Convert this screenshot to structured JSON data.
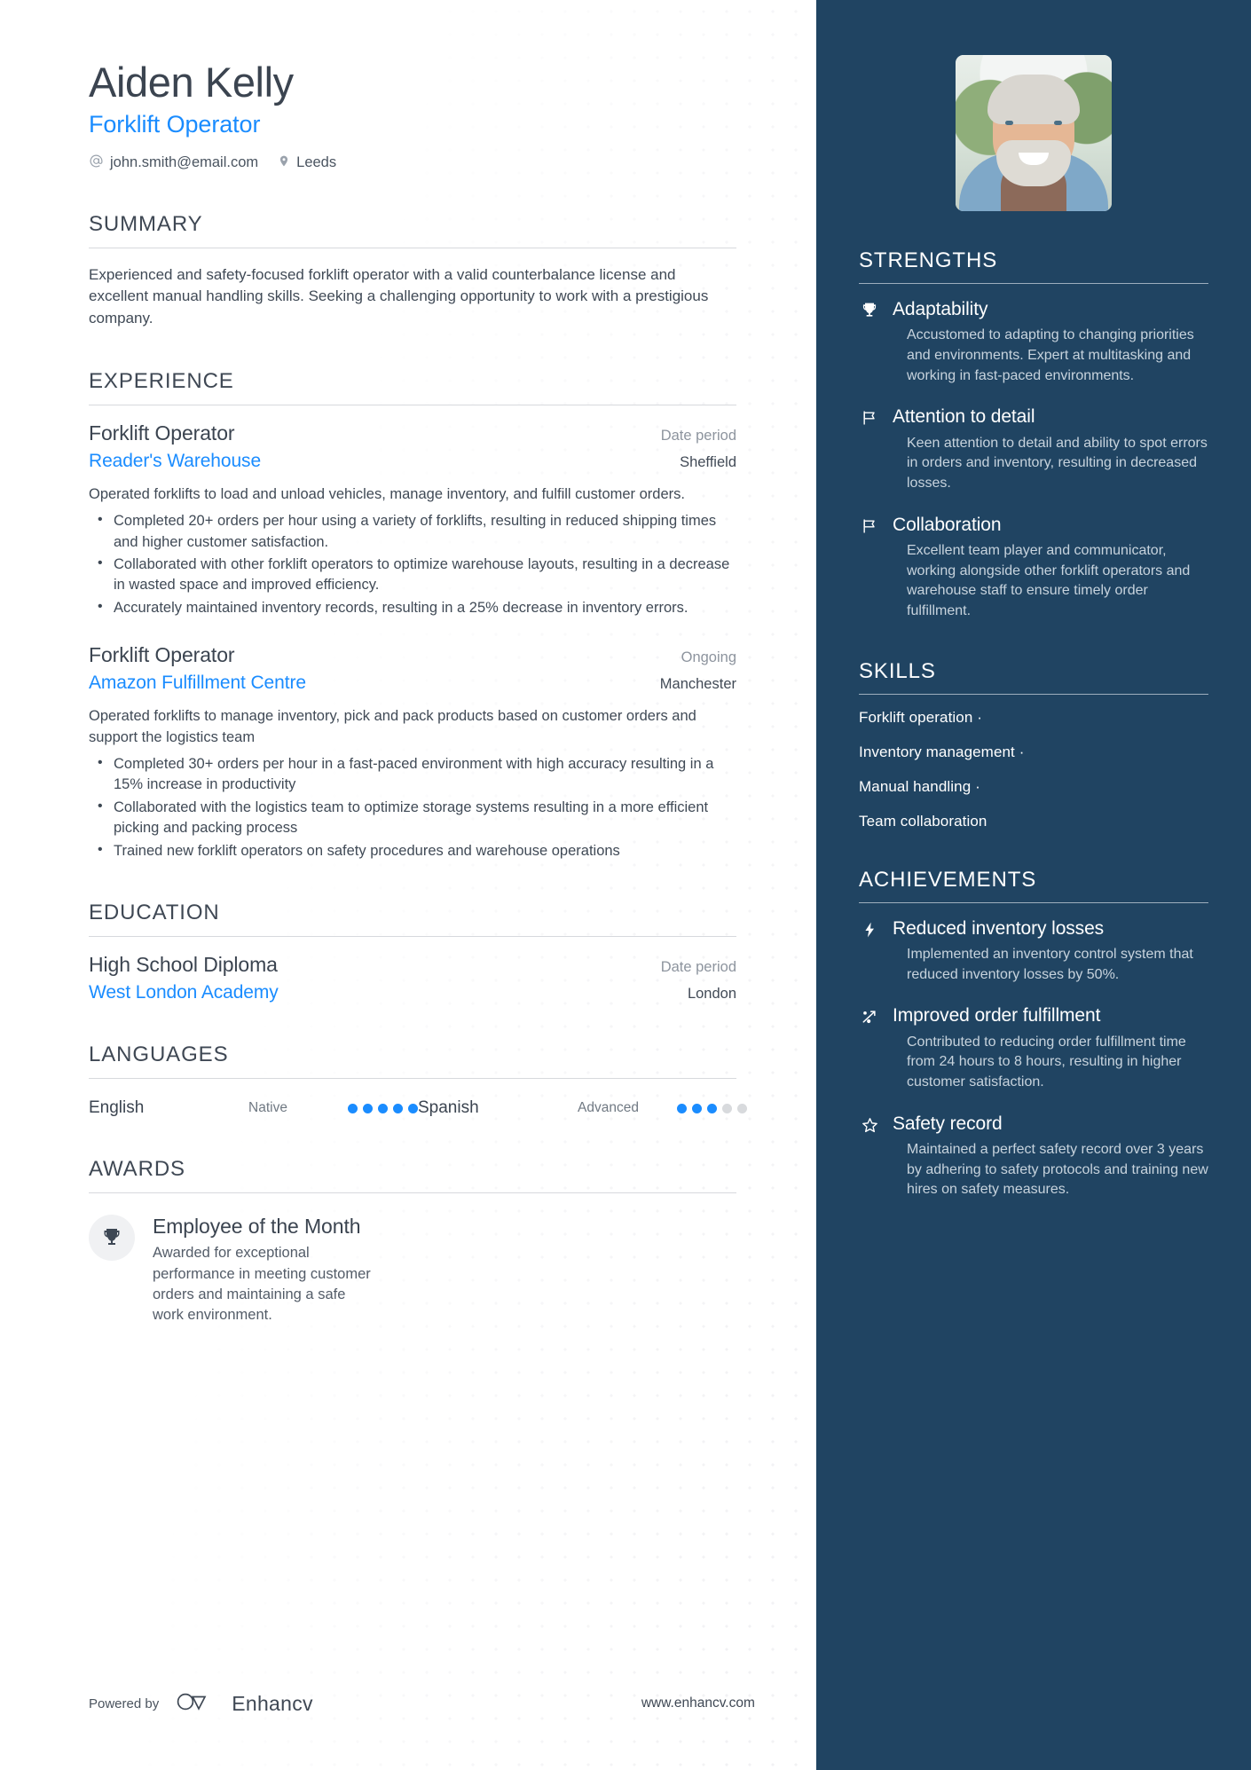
{
  "header": {
    "name": "Aiden Kelly",
    "job_title": "Forklift Operator",
    "email": "john.smith@email.com",
    "location": "Leeds",
    "email_icon": "at-icon",
    "location_icon": "map-pin-icon",
    "avatar_alt": "avatar"
  },
  "accent_color": "#1a8cff",
  "sidebar_color": "#204462",
  "sections": {
    "summary": {
      "title": "SUMMARY",
      "text": "Experienced and safety-focused forklift operator with a valid counterbalance license and excellent manual handling skills. Seeking a challenging opportunity to work with a prestigious company."
    },
    "experience": {
      "title": "EXPERIENCE",
      "entries": [
        {
          "role": "Forklift Operator",
          "date": "Date period",
          "org": "Reader's Warehouse",
          "location": "Sheffield",
          "description": "Operated forklifts to load and unload vehicles, manage inventory, and fulfill customer orders.",
          "bullets": [
            "Completed 20+ orders per hour using a variety of forklifts, resulting in reduced shipping times and higher customer satisfaction.",
            "Collaborated with other forklift operators to optimize warehouse layouts, resulting in a decrease in wasted space and improved efficiency.",
            "Accurately maintained inventory records, resulting in a 25% decrease in inventory errors."
          ]
        },
        {
          "role": "Forklift Operator",
          "date": "Ongoing",
          "org": "Amazon Fulfillment Centre",
          "location": "Manchester",
          "description": "Operated forklifts to manage inventory, pick and pack products based on customer orders and support the logistics team",
          "bullets": [
            "Completed 30+ orders per hour in a fast-paced environment with high accuracy resulting in a 15% increase in productivity",
            "Collaborated with the logistics team to optimize storage systems resulting in a more efficient picking and packing process",
            "Trained new forklift operators on safety procedures and warehouse operations"
          ]
        }
      ]
    },
    "education": {
      "title": "EDUCATION",
      "entries": [
        {
          "degree": "High School Diploma",
          "date": "Date period",
          "school": "West London Academy",
          "location": "London"
        }
      ]
    },
    "languages": {
      "title": "LANGUAGES",
      "items": [
        {
          "name": "English",
          "level": "Native",
          "rating": 5,
          "max": 5
        },
        {
          "name": "Spanish",
          "level": "Advanced",
          "rating": 3,
          "max": 5
        }
      ]
    },
    "awards": {
      "title": "AWARDS",
      "items": [
        {
          "icon": "trophy-icon",
          "title": "Employee of the Month",
          "description": "Awarded for exceptional performance in meeting customer orders and maintaining a safe work environment."
        }
      ]
    },
    "strengths": {
      "title": "STRENGTHS",
      "items": [
        {
          "icon": "trophy-icon",
          "title": "Adaptability",
          "description": "Accustomed to adapting to changing priorities and environments. Expert at multitasking and working in fast-paced environments."
        },
        {
          "icon": "flag-icon",
          "title": "Attention to detail",
          "description": "Keen attention to detail and ability to spot errors in orders and inventory, resulting in decreased losses."
        },
        {
          "icon": "flag-icon",
          "title": "Collaboration",
          "description": "Excellent team player and communicator, working alongside other forklift operators and warehouse staff to ensure timely order fulfillment."
        }
      ]
    },
    "skills": {
      "title": "SKILLS",
      "items": [
        "Forklift operation ·",
        "Inventory management ·",
        "Manual handling ·",
        "Team collaboration"
      ]
    },
    "achievements": {
      "title": "ACHIEVEMENTS",
      "items": [
        {
          "icon": "lightning-bolt-icon",
          "title": "Reduced inventory losses",
          "description": "Implemented an inventory control system that reduced inventory losses by 50%."
        },
        {
          "icon": "chart-arrow-icon",
          "title": "Improved order fulfillment",
          "description": "Contributed to reducing order fulfillment time from 24 hours to 8 hours, resulting in higher customer satisfaction."
        },
        {
          "icon": "star-icon",
          "title": "Safety record",
          "description": "Maintained a perfect safety record over 3 years by adhering to safety protocols and training new hires on safety measures."
        }
      ]
    }
  },
  "footer": {
    "powered_by": "Powered by",
    "brand": "Enhancv",
    "brand_logo": "enhancv-logo-icon",
    "url": "www.enhancv.com"
  }
}
